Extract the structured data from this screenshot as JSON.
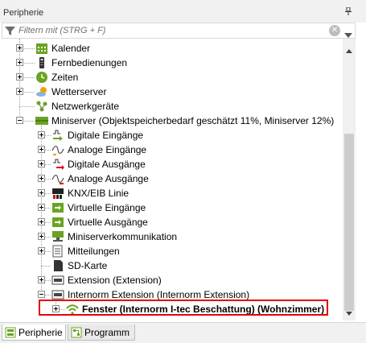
{
  "panel": {
    "title": "Peripherie",
    "pin_glyph": "↕"
  },
  "filter": {
    "placeholder": "Filtern mit (STRG + F)",
    "value": ""
  },
  "tree": [
    {
      "label": "Kalender",
      "icon": "calendar-icon",
      "color": "#6aa322",
      "level": 0,
      "expander": "plus",
      "name": "kalender"
    },
    {
      "label": "Fernbedienungen",
      "icon": "remote-control-icon",
      "color": "#333333",
      "level": 0,
      "expander": "plus",
      "name": "fernbedienungen"
    },
    {
      "label": "Zeiten",
      "icon": "clock-icon",
      "color": "#6aa322",
      "level": 0,
      "expander": "plus",
      "name": "zeiten"
    },
    {
      "label": "Wetterserver",
      "icon": "weather-icon",
      "color": "#f2a100",
      "level": 0,
      "expander": "plus",
      "name": "wetterserver"
    },
    {
      "label": "Netzwerkgeräte",
      "icon": "network-icon",
      "color": "#6aa322",
      "level": 0,
      "expander": "none",
      "name": "netzwerkgeraete"
    },
    {
      "label": "Miniserver (Objektspeicherbedarf geschätzt 11%, Miniserver 12%)",
      "icon": "miniserver-icon",
      "color": "#6aa322",
      "level": 0,
      "expander": "minus",
      "name": "miniserver"
    },
    {
      "label": "Digitale Eingänge",
      "icon": "digital-input-icon",
      "color": "#6aa322",
      "level": 1,
      "expander": "plus",
      "name": "digitale-eingaenge"
    },
    {
      "label": "Analoge Eingänge",
      "icon": "analog-input-icon",
      "color": "#f2a100",
      "level": 1,
      "expander": "plus",
      "name": "analoge-eingaenge"
    },
    {
      "label": "Digitale Ausgänge",
      "icon": "digital-output-icon",
      "color": "#e3000b",
      "level": 1,
      "expander": "plus",
      "name": "digitale-ausgaenge"
    },
    {
      "label": "Analoge Ausgänge",
      "icon": "analog-output-icon",
      "color": "#e3000b",
      "level": 1,
      "expander": "plus",
      "name": "analoge-ausgaenge"
    },
    {
      "label": "KNX/EIB Linie",
      "icon": "knx-icon",
      "color": "#222222",
      "level": 1,
      "expander": "plus",
      "name": "knx-eib-linie"
    },
    {
      "label": "Virtuelle Eingänge",
      "icon": "virtual-input-icon",
      "color": "#6aa322",
      "level": 1,
      "expander": "plus",
      "name": "virtuelle-eingaenge"
    },
    {
      "label": "Virtuelle Ausgänge",
      "icon": "virtual-output-icon",
      "color": "#6aa322",
      "level": 1,
      "expander": "plus",
      "name": "virtuelle-ausgaenge"
    },
    {
      "label": "Miniserverkommunikation",
      "icon": "miniserver-comm-icon",
      "color": "#6aa322",
      "level": 1,
      "expander": "plus",
      "name": "miniserverkommunikation"
    },
    {
      "label": "Mitteilungen",
      "icon": "messages-icon",
      "color": "#555555",
      "level": 1,
      "expander": "plus",
      "name": "mitteilungen"
    },
    {
      "label": "SD-Karte",
      "icon": "sd-card-icon",
      "color": "#333333",
      "level": 1,
      "expander": "none",
      "name": "sd-karte"
    },
    {
      "label": "Extension (Extension)",
      "icon": "extension-icon",
      "color": "#444444",
      "level": 1,
      "expander": "plus",
      "name": "extension"
    },
    {
      "label": "Internorm Extension (Internorm Extension)",
      "icon": "internorm-extension-icon",
      "color": "#444444",
      "level": 1,
      "expander": "minus",
      "name": "internorm-extension"
    },
    {
      "label": "Fenster (Internorm I-tec Beschattung) (Wohnzimmer)",
      "icon": "wifi-icon",
      "color": "#6aa322",
      "level": 2,
      "expander": "plus",
      "name": "fenster",
      "bold": true
    }
  ],
  "tabs": [
    {
      "label": "Peripherie",
      "icon": "peripherals-icon",
      "active": true
    },
    {
      "label": "Programm",
      "icon": "program-icon",
      "active": false
    }
  ],
  "colors": {
    "highlight": "#e3000b",
    "accent_green": "#6aa322"
  }
}
